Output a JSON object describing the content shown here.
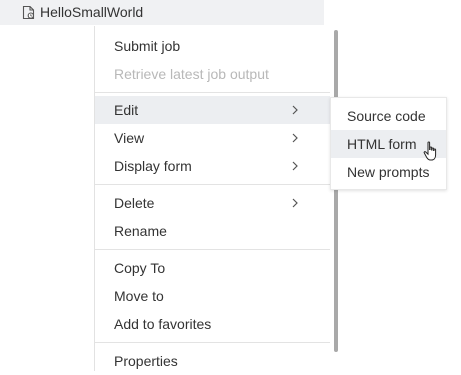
{
  "tree": {
    "item_label": "HelloSmallWorld",
    "icon": "file-code-icon"
  },
  "context_menu": {
    "items": [
      {
        "label": "Submit job",
        "enabled": true
      },
      {
        "label": "Retrieve latest job output",
        "enabled": false
      },
      {
        "label": "Edit",
        "has_submenu": true,
        "active": true
      },
      {
        "label": "View",
        "has_submenu": true
      },
      {
        "label": "Display form",
        "has_submenu": true
      },
      {
        "label": "Delete",
        "has_submenu": true
      },
      {
        "label": "Rename"
      },
      {
        "label": "Copy To"
      },
      {
        "label": "Move to"
      },
      {
        "label": "Add to favorites"
      },
      {
        "label": "Properties"
      }
    ]
  },
  "edit_submenu": {
    "items": [
      {
        "label": "Source code"
      },
      {
        "label": "HTML form",
        "hovered": true
      },
      {
        "label": "New prompts"
      }
    ]
  },
  "colors": {
    "hover_bg": "#eceef1",
    "disabled_text": "#b8b8b8",
    "text": "#333333",
    "separator": "#e3e3e3"
  }
}
